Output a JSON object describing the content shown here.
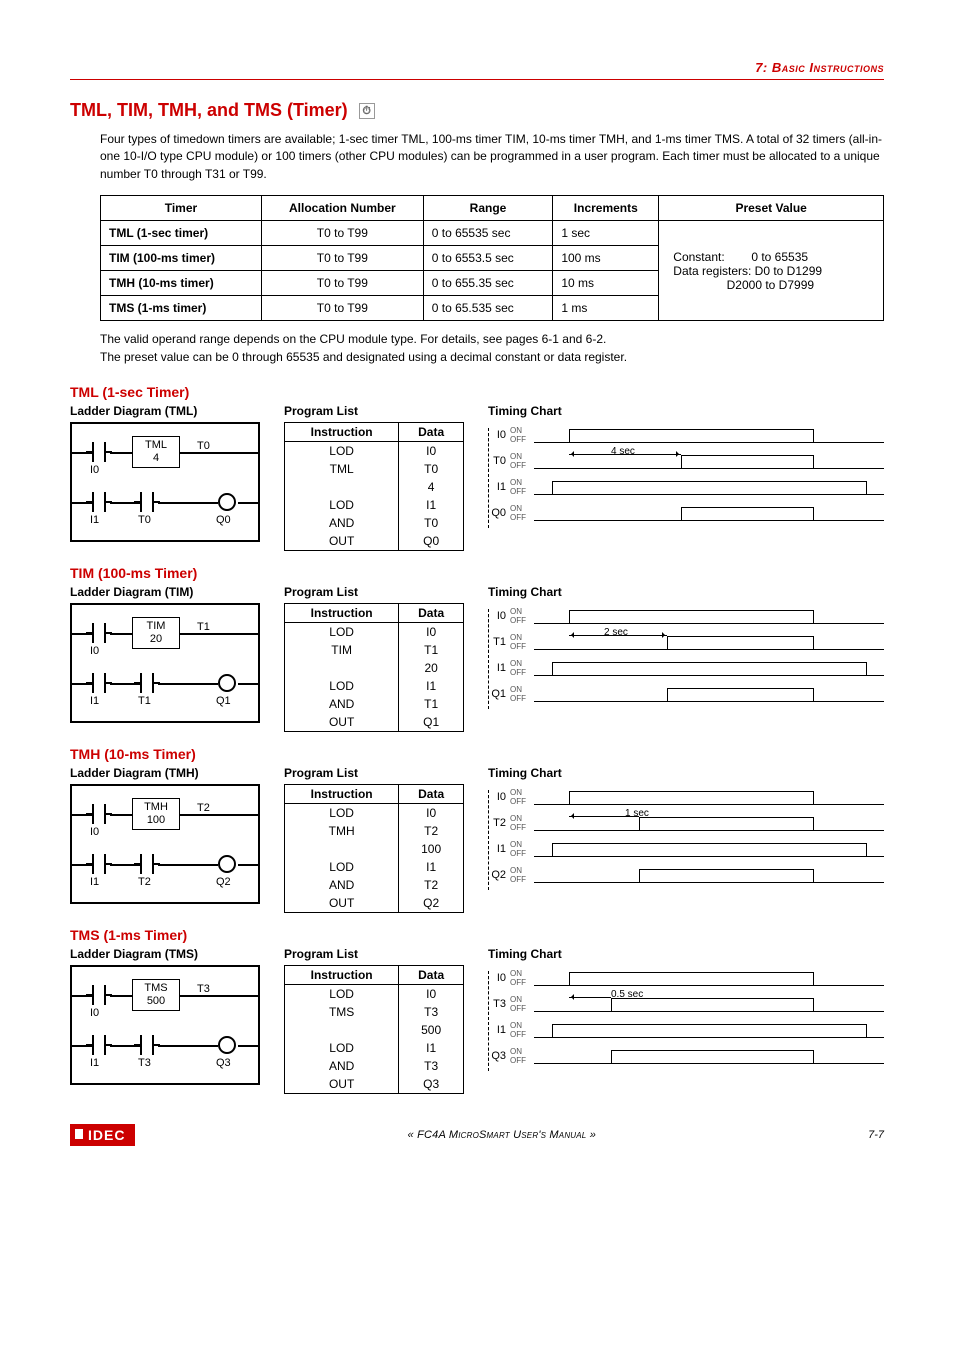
{
  "chapter": "7: Basic Instructions",
  "title": "TML, TIM, TMH, and TMS (Timer)",
  "title_icon_glyph": "⏱",
  "intro": "Four types of timedown timers are available; 1-sec timer TML, 100-ms timer TIM, 10-ms timer TMH, and 1-ms timer TMS. A total of 32 timers (all-in-one 10-I/O type CPU module) or 100 timers (other CPU modules) can be programmed in a user program. Each timer must be allocated to a unique number T0 through T31 or T99.",
  "main_table": {
    "headers": [
      "Timer",
      "Allocation Number",
      "Range",
      "Increments",
      "Preset Value"
    ],
    "rows": [
      [
        "TML (1-sec timer)",
        "T0 to T99",
        "0 to 65535 sec",
        "1 sec"
      ],
      [
        "TIM (100-ms timer)",
        "T0 to T99",
        "0 to 6553.5 sec",
        "100 ms"
      ],
      [
        "TMH (10-ms timer)",
        "T0 to T99",
        "0 to 655.35 sec",
        "10 ms"
      ],
      [
        "TMS (1-ms timer)",
        "T0 to T99",
        "0 to 65.535 sec",
        "1 ms"
      ]
    ],
    "preset_lines": [
      "Constant:        0 to 65535",
      "Data registers: D0 to D1299",
      "                D2000 to D7999"
    ]
  },
  "note1": "The valid operand range depends on the CPU module type. For details, see pages 6-1 and 6-2.",
  "note2": "The preset value can be 0 through 65535 and designated using a decimal constant or data register.",
  "labels": {
    "ladder": "Ladder Diagram",
    "program": "Program List",
    "chart": "Timing Chart",
    "instruction": "Instruction",
    "data": "Data",
    "on": "ON",
    "off": "OFF"
  },
  "sections": [
    {
      "title": "TML (1-sec Timer)",
      "ladder_label": "Ladder Diagram (TML)",
      "ladder": {
        "mnemonic": "TML",
        "preset": "4",
        "timer": "T0",
        "in": "I0",
        "in2": "I1",
        "out": "Q0"
      },
      "program": [
        [
          "LOD",
          "I0"
        ],
        [
          "TML",
          "T0"
        ],
        [
          "",
          "4"
        ],
        [
          "LOD",
          "I1"
        ],
        [
          "AND",
          "T0"
        ],
        [
          "OUT",
          "Q0"
        ]
      ],
      "chart": {
        "rows": [
          "I0",
          "T0",
          "I1",
          "Q0"
        ],
        "anno": "4 sec"
      }
    },
    {
      "title": "TIM (100-ms Timer)",
      "ladder_label": "Ladder Diagram (TIM)",
      "ladder": {
        "mnemonic": "TIM",
        "preset": "20",
        "timer": "T1",
        "in": "I0",
        "in2": "I1",
        "out": "Q1"
      },
      "program": [
        [
          "LOD",
          "I0"
        ],
        [
          "TIM",
          "T1"
        ],
        [
          "",
          "20"
        ],
        [
          "LOD",
          "I1"
        ],
        [
          "AND",
          "T1"
        ],
        [
          "OUT",
          "Q1"
        ]
      ],
      "chart": {
        "rows": [
          "I0",
          "T1",
          "I1",
          "Q1"
        ],
        "anno": "2 sec"
      }
    },
    {
      "title": "TMH (10-ms Timer)",
      "ladder_label": "Ladder Diagram (TMH)",
      "ladder": {
        "mnemonic": "TMH",
        "preset": "100",
        "timer": "T2",
        "in": "I0",
        "in2": "I1",
        "out": "Q2"
      },
      "program": [
        [
          "LOD",
          "I0"
        ],
        [
          "TMH",
          "T2"
        ],
        [
          "",
          "100"
        ],
        [
          "LOD",
          "I1"
        ],
        [
          "AND",
          "T2"
        ],
        [
          "OUT",
          "Q2"
        ]
      ],
      "chart": {
        "rows": [
          "I0",
          "T2",
          "I1",
          "Q2"
        ],
        "anno": "1 sec"
      }
    },
    {
      "title": "TMS (1-ms Timer)",
      "ladder_label": "Ladder Diagram (TMS)",
      "ladder": {
        "mnemonic": "TMS",
        "preset": "500",
        "timer": "T3",
        "in": "I0",
        "in2": "I1",
        "out": "Q3"
      },
      "program": [
        [
          "LOD",
          "I0"
        ],
        [
          "TMS",
          "T3"
        ],
        [
          "",
          "500"
        ],
        [
          "LOD",
          "I1"
        ],
        [
          "AND",
          "T3"
        ],
        [
          "OUT",
          "Q3"
        ]
      ],
      "chart": {
        "rows": [
          "I0",
          "T3",
          "I1",
          "Q3"
        ],
        "anno": "0.5 sec"
      }
    }
  ],
  "chart_data": [
    {
      "type": "timing",
      "title": "TML Timing Chart",
      "annotation": "4 sec",
      "signals": [
        {
          "name": "I0",
          "segments": [
            {
              "start": 10,
              "end": 80,
              "level": "ON"
            }
          ]
        },
        {
          "name": "T0",
          "segments": [
            {
              "start": 42,
              "end": 80,
              "level": "ON"
            }
          ]
        },
        {
          "name": "I1",
          "segments": [
            {
              "start": 5,
              "end": 95,
              "level": "ON"
            }
          ]
        },
        {
          "name": "Q0",
          "segments": [
            {
              "start": 42,
              "end": 80,
              "level": "ON"
            }
          ]
        }
      ]
    },
    {
      "type": "timing",
      "title": "TIM Timing Chart",
      "annotation": "2 sec",
      "signals": [
        {
          "name": "I0",
          "segments": [
            {
              "start": 10,
              "end": 80,
              "level": "ON"
            }
          ]
        },
        {
          "name": "T1",
          "segments": [
            {
              "start": 38,
              "end": 80,
              "level": "ON"
            }
          ]
        },
        {
          "name": "I1",
          "segments": [
            {
              "start": 5,
              "end": 95,
              "level": "ON"
            }
          ]
        },
        {
          "name": "Q1",
          "segments": [
            {
              "start": 38,
              "end": 80,
              "level": "ON"
            }
          ]
        }
      ]
    },
    {
      "type": "timing",
      "title": "TMH Timing Chart",
      "annotation": "1 sec",
      "signals": [
        {
          "name": "I0",
          "segments": [
            {
              "start": 10,
              "end": 80,
              "level": "ON"
            }
          ]
        },
        {
          "name": "T2",
          "segments": [
            {
              "start": 30,
              "end": 80,
              "level": "ON"
            }
          ]
        },
        {
          "name": "I1",
          "segments": [
            {
              "start": 5,
              "end": 95,
              "level": "ON"
            }
          ]
        },
        {
          "name": "Q2",
          "segments": [
            {
              "start": 30,
              "end": 80,
              "level": "ON"
            }
          ]
        }
      ]
    },
    {
      "type": "timing",
      "title": "TMS Timing Chart",
      "annotation": "0.5 sec",
      "signals": [
        {
          "name": "I0",
          "segments": [
            {
              "start": 10,
              "end": 80,
              "level": "ON"
            }
          ]
        },
        {
          "name": "T3",
          "segments": [
            {
              "start": 22,
              "end": 80,
              "level": "ON"
            }
          ]
        },
        {
          "name": "I1",
          "segments": [
            {
              "start": 5,
              "end": 95,
              "level": "ON"
            }
          ]
        },
        {
          "name": "Q3",
          "segments": [
            {
              "start": 22,
              "end": 80,
              "level": "ON"
            }
          ]
        }
      ]
    }
  ],
  "footer": {
    "brand": "IDEC",
    "center": "« FC4A MicroSmart User's Manual »",
    "page": "7-7"
  }
}
